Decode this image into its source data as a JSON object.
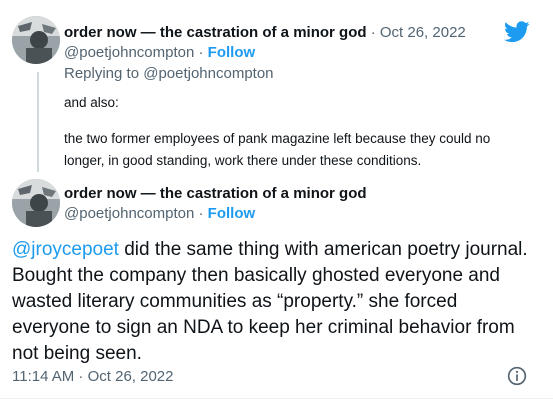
{
  "brand": {
    "icon": "twitter-bird-icon",
    "color": "#1d9bf0"
  },
  "reply_tweet": {
    "author_name": "order now — the castration of a minor god",
    "separator": "·",
    "date": "Oct 26, 2022",
    "handle": "@poetjohncompton",
    "follow_label": "Follow",
    "replying_to": "Replying to @poetjohncompton",
    "body_paragraphs": [
      "and also:",
      "the two former employees of pank magazine left because they could no longer, in good standing, work there under these conditions."
    ]
  },
  "main_tweet": {
    "author_name": "order now — the castration of a minor god",
    "handle": "@poetjohncompton",
    "separator": "·",
    "follow_label": "Follow",
    "mention": "@jroycepoet",
    "text_after_mention": " did the same thing with american poetry journal. Bought the company then basically ghosted everyone and wasted literary communities as “property.” she forced everyone to sign an NDA to keep her criminal behavior from not being seen.",
    "timestamp": "11:14 AM · Oct 26, 2022",
    "info_icon": "info-circle-icon"
  },
  "colors": {
    "link": "#1d9bf0",
    "secondary_text": "#536471",
    "thread_line": "#cfd9de"
  }
}
